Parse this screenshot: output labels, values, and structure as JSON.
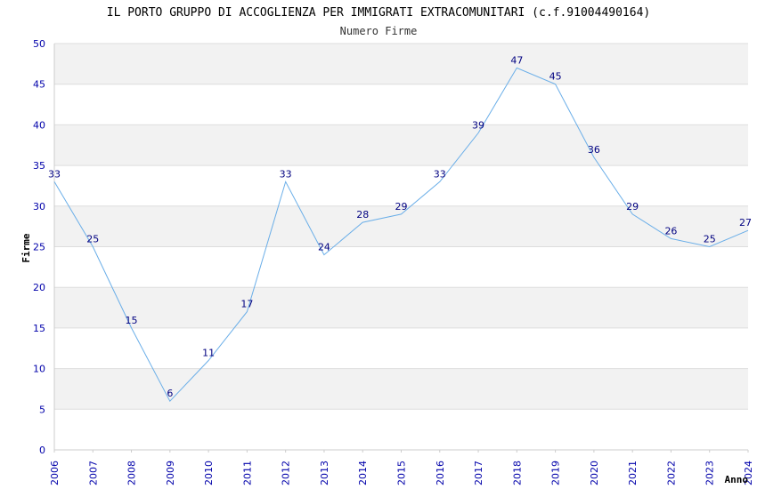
{
  "chart_data": {
    "type": "line",
    "title": "IL PORTO GRUPPO DI ACCOGLIENZA PER IMMIGRATI EXTRACOMUNITARI (c.f.91004490164)",
    "subtitle": "Numero Firme",
    "xlabel": "Anno",
    "ylabel": "Firme",
    "ylim": [
      0,
      50
    ],
    "yticks": [
      "0",
      "5",
      "10",
      "15",
      "20",
      "25",
      "30",
      "35",
      "40",
      "45",
      "50"
    ],
    "categories": [
      "2006",
      "2007",
      "2008",
      "2009",
      "2010",
      "2011",
      "2012",
      "2013",
      "2014",
      "2015",
      "2016",
      "2017",
      "2018",
      "2019",
      "2020",
      "2021",
      "2022",
      "2023",
      "2024"
    ],
    "series": [
      {
        "values": [
          33,
          25,
          15,
          6,
          11,
          17,
          33,
          24,
          28,
          29,
          33,
          39,
          47,
          45,
          36,
          29,
          26,
          25,
          27
        ]
      }
    ],
    "grid": true,
    "colors": {
      "line": "#6aaee8",
      "band": "#f2f2f2",
      "grid": "#dddddd",
      "tick_text": "#0000aa",
      "data_label": "#000080"
    }
  }
}
